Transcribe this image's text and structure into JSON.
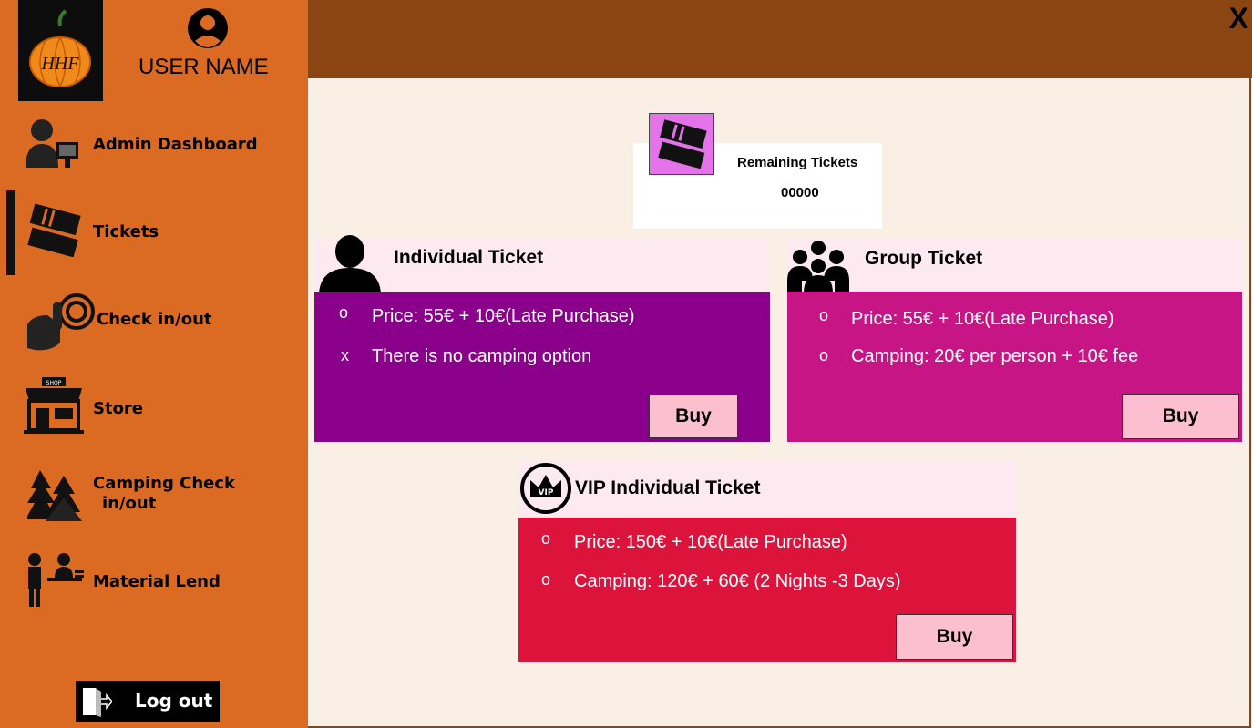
{
  "user": {
    "name": "USER NAME"
  },
  "logo": {
    "text": "HHF"
  },
  "nav": {
    "items": [
      {
        "label": "Admin Dashboard",
        "icon": "admin-icon"
      },
      {
        "label": "Tickets",
        "icon": "ticket-icon"
      },
      {
        "label": "Check in/out",
        "icon": "checkin-icon"
      },
      {
        "label": "Store",
        "icon": "store-icon"
      },
      {
        "label": "Camping Check",
        "label2": "in/out",
        "icon": "camping-icon"
      },
      {
        "label": "Material Lend",
        "icon": "material-lend-icon"
      }
    ],
    "active": "Tickets",
    "logout": "Log out"
  },
  "window": {
    "close": "X"
  },
  "remaining": {
    "title": "Remaining Tickets",
    "value": "00000"
  },
  "cards": {
    "individual": {
      "title": "Individual Ticket",
      "color": "#8b008b",
      "bullets": [
        "o",
        "x"
      ],
      "lines": [
        "Price: 55€ + 10€(Late Purchase)",
        "There is no camping option"
      ],
      "buy": "Buy"
    },
    "group": {
      "title": "Group Ticket",
      "color": "#c71585",
      "bullets": [
        "o",
        "o"
      ],
      "lines": [
        "Price: 55€ + 10€(Late Purchase)",
        "Camping: 20€ per person + 10€ fee"
      ],
      "buy": "Buy"
    },
    "vip": {
      "title": "VIP Individual Ticket",
      "color": "#dc143c",
      "bullets": [
        "o",
        "o"
      ],
      "lines": [
        "Price: 150€ + 10€(Late Purchase)",
        "Camping: 120€ + 60€ (2 Nights -3 Days)"
      ],
      "buy": "Buy"
    }
  },
  "colors": {
    "sidebar": "#db6a23",
    "topbar": "#8b4513",
    "content": "#faefe5",
    "buy": "#fcbfcf"
  }
}
